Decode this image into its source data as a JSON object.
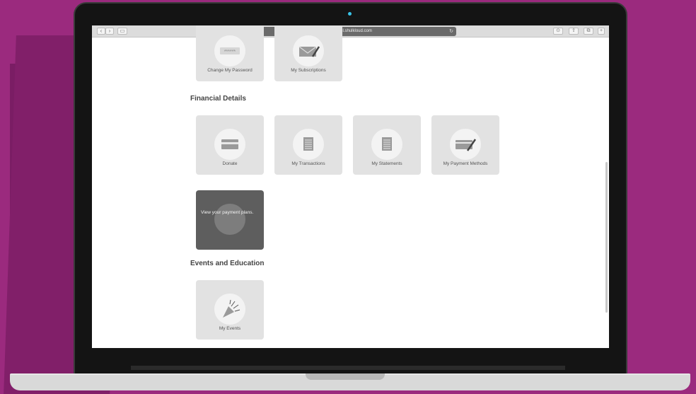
{
  "browser": {
    "url": "lalhuhul.shulkloud.com"
  },
  "sections": {
    "account_tiles": [
      {
        "label": "Change My Password",
        "icon": "password-icon"
      },
      {
        "label": "My Subscriptions",
        "icon": "envelope-pen-icon"
      }
    ],
    "financial": {
      "title": "Financial Details",
      "tiles": [
        {
          "label": "Donate",
          "icon": "card-icon"
        },
        {
          "label": "My Transactions",
          "icon": "document-icon"
        },
        {
          "label": "My Statements",
          "icon": "document-icon"
        },
        {
          "label": "My Payment Methods",
          "icon": "card-pen-icon"
        }
      ],
      "payment_plans_hover": "View your payment plans."
    },
    "events": {
      "title": "Events and Education",
      "tiles": [
        {
          "label": "My Events",
          "icon": "party-popper-icon"
        }
      ]
    }
  },
  "colors": {
    "background": "#9b2a7e",
    "tile": "#e2e2e2",
    "tile_active": "#5e5e5e",
    "camera": "#39c4e8"
  }
}
